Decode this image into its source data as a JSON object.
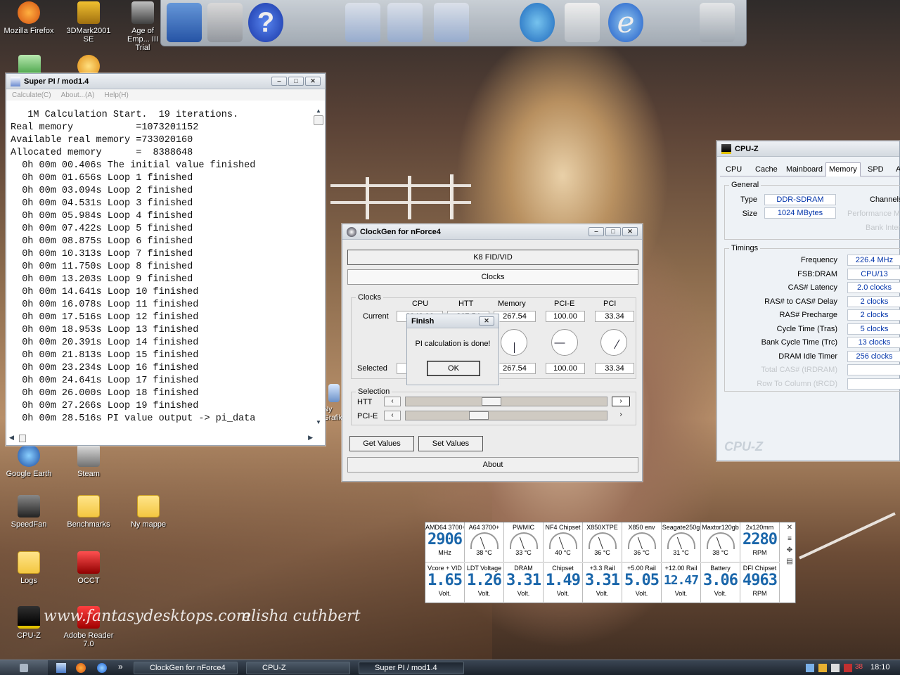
{
  "desktop": {
    "icons": [
      {
        "label": "Mozilla Firefox",
        "icon": "firefox-icon"
      },
      {
        "label": "3DMark2001 SE",
        "icon": "3dmark-icon"
      },
      {
        "label": "Age of Emp... III Trial",
        "icon": "aoe-icon"
      },
      {
        "label": "Google Earth",
        "icon": "google-earth-icon"
      },
      {
        "label": "Steam",
        "icon": "steam-icon"
      },
      {
        "label": "SpeedFan",
        "icon": "speedfan-icon"
      },
      {
        "label": "Benchmarks",
        "icon": "folder-icon"
      },
      {
        "label": "Ny mappe",
        "icon": "folder-icon"
      },
      {
        "label": "Logs",
        "icon": "folder-icon"
      },
      {
        "label": "OCCT",
        "icon": "occt-icon"
      },
      {
        "label": "CPU-Z",
        "icon": "cpuz-icon"
      },
      {
        "label": "Adobe Reader 7.0",
        "icon": "adobe-reader-icon"
      }
    ],
    "watermark_site": "www.fantasydesktops.com",
    "watermark_name": "elisha cuthbert",
    "partial_icon_label": "Ny Grafikk"
  },
  "superpi": {
    "title": "Super PI / mod1.4",
    "menu": [
      "Calculate(C)",
      "About...(A)",
      "Help(H)"
    ],
    "lines": [
      "   1M Calculation Start.  19 iterations.",
      "Real memory           =1073201152",
      "Available real memory =733020160",
      "Allocated memory      =  8388648",
      "  0h 00m 00.406s The initial value finished",
      "  0h 00m 01.656s Loop 1 finished",
      "  0h 00m 03.094s Loop 2 finished",
      "  0h 00m 04.531s Loop 3 finished",
      "  0h 00m 05.984s Loop 4 finished",
      "  0h 00m 07.422s Loop 5 finished",
      "  0h 00m 08.875s Loop 6 finished",
      "  0h 00m 10.313s Loop 7 finished",
      "  0h 00m 11.750s Loop 8 finished",
      "  0h 00m 13.203s Loop 9 finished",
      "  0h 00m 14.641s Loop 10 finished",
      "  0h 00m 16.078s Loop 11 finished",
      "  0h 00m 17.516s Loop 12 finished",
      "  0h 00m 18.953s Loop 13 finished",
      "  0h 00m 20.391s Loop 14 finished",
      "  0h 00m 21.813s Loop 15 finished",
      "  0h 00m 23.234s Loop 16 finished",
      "  0h 00m 24.641s Loop 17 finished",
      "  0h 00m 26.000s Loop 18 finished",
      "  0h 00m 27.266s Loop 19 finished",
      "  0h 00m 28.516s PI value output -> pi_data"
    ]
  },
  "clockgen": {
    "title": "ClockGen for nForce4",
    "k8_button": "K8 FID/VID",
    "clocks_button": "Clocks",
    "clocks_group": "Clocks",
    "columns": [
      "CPU",
      "HTT",
      "Memory",
      "PCI-E",
      "PCI"
    ],
    "current_label": "Current",
    "current_values": [
      "2942.96",
      "267.54",
      "267.54",
      "100.00",
      "33.34"
    ],
    "selected_label": "Selected",
    "selected_values": [
      "",
      "",
      "267.54",
      "100.00",
      "33.34"
    ],
    "selection_group": "Selection",
    "htt_label": "HTT",
    "pcie_label": "PCI-E",
    "htt_slider_level": 0.42,
    "pcie_slider_level": 0.35,
    "get_values": "Get Values",
    "set_values": "Set Values",
    "about": "About"
  },
  "finish_dialog": {
    "title": "Finish",
    "message": "PI calculation is done!",
    "ok": "OK"
  },
  "cpuz": {
    "title": "CPU-Z",
    "watermark": "CPU-Z",
    "tabs": [
      "CPU",
      "Cache",
      "Mainboard",
      "Memory",
      "SPD",
      "A"
    ],
    "active_tab": "Memory",
    "general_group": "General",
    "type_label": "Type",
    "type_value": "DDR-SDRAM",
    "size_label": "Size",
    "size_value": "1024 MBytes",
    "channels_label": "Channels",
    "perf_mode_label": "Performance Mo",
    "bank_interleave_label": "Bank Interle",
    "timings_group": "Timings",
    "timings": [
      {
        "label": "Frequency",
        "value": "226.4 MHz"
      },
      {
        "label": "FSB:DRAM",
        "value": "CPU/13"
      },
      {
        "label": "CAS# Latency",
        "value": "2.0 clocks"
      },
      {
        "label": "RAS# to CAS# Delay",
        "value": "2 clocks"
      },
      {
        "label": "RAS# Precharge",
        "value": "2 clocks"
      },
      {
        "label": "Cycle Time (Tras)",
        "value": "5 clocks"
      },
      {
        "label": "Bank Cycle Time (Trc)",
        "value": "13 clocks"
      },
      {
        "label": "DRAM Idle Timer",
        "value": "256 clocks"
      },
      {
        "label": "Total CAS# (tRDRAM)",
        "value": ""
      },
      {
        "label": "Row To Column (tRCD)",
        "value": ""
      }
    ]
  },
  "sensors": {
    "top": [
      {
        "name": "AMD64 3700+",
        "value": "2906",
        "unit": "MHz"
      },
      {
        "name": "A64 3700+",
        "value": "",
        "unit": "38 °C"
      },
      {
        "name": "PWMIC",
        "value": "",
        "unit": "33 °C"
      },
      {
        "name": "NF4 Chipset",
        "value": "",
        "unit": "40 °C"
      },
      {
        "name": "X850XTPE",
        "value": "",
        "unit": "36 °C"
      },
      {
        "name": "X850 env",
        "value": "",
        "unit": "36 °C"
      },
      {
        "name": "Seagate250g",
        "value": "",
        "unit": "31 °C"
      },
      {
        "name": "Maxtor120gb",
        "value": "",
        "unit": "38 °C"
      },
      {
        "name": "2x120mm",
        "value": "2280",
        "unit": "RPM"
      }
    ],
    "bottom": [
      {
        "name": "Vcore + VID",
        "value": "1.65",
        "unit": "Volt."
      },
      {
        "name": "LDT Voltage",
        "value": "1.26",
        "unit": "Volt."
      },
      {
        "name": "DRAM",
        "value": "3.31",
        "unit": "Volt."
      },
      {
        "name": "Chipset",
        "value": "1.49",
        "unit": "Volt."
      },
      {
        "name": "+3.3 Rail",
        "value": "3.31",
        "unit": "Volt."
      },
      {
        "name": "+5.00 Rail",
        "value": "5.05",
        "unit": "Volt."
      },
      {
        "name": "+12.00 Rail",
        "value": "12.47",
        "unit": "Volt."
      },
      {
        "name": "Battery",
        "value": "3.06",
        "unit": "Volt."
      },
      {
        "name": "DFI Chipset",
        "value": "4963",
        "unit": "RPM"
      }
    ]
  },
  "taskbar": {
    "items": [
      "ClockGen for nForce4",
      "CPU-Z",
      "Super PI / mod1.4"
    ],
    "clock": "18:10",
    "tray_badge": "38"
  }
}
